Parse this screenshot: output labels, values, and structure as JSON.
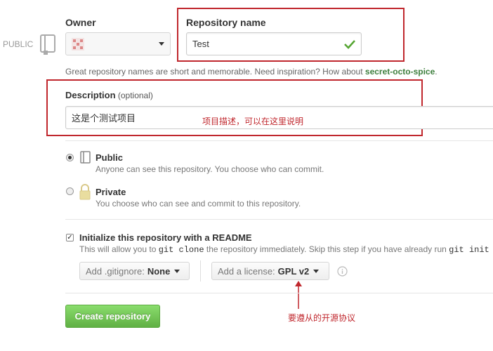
{
  "public_tag": "PUBLIC",
  "owner": {
    "label": "Owner"
  },
  "repo_name": {
    "label": "Repository name",
    "value": "Test"
  },
  "hint": {
    "prefix": "Great repository names are short and memorable. Need inspiration? How about ",
    "suggestion": "secret-octo-spice",
    "suffix": "."
  },
  "description": {
    "label": "Description",
    "optional": "(optional)",
    "value": "这是个测试项目",
    "annotation": "项目描述，可以在这里说明"
  },
  "visibility": {
    "public_label": "Public",
    "public_desc": "Anyone can see this repository. You choose who can commit.",
    "private_label": "Private",
    "private_desc": "You choose who can see and commit to this repository."
  },
  "init": {
    "label": "Initialize this repository with a README",
    "desc_pre": "This will allow you to ",
    "desc_code1": "git clone",
    "desc_mid": " the repository immediately. Skip this step if you have already run ",
    "desc_code2": "git init"
  },
  "gitignore": {
    "prefix": "Add .gitignore:",
    "value": "None"
  },
  "license": {
    "prefix": "Add a license:",
    "value": "GPL v2",
    "annotation": "要遵从的开源协议"
  },
  "create_button": "Create repository",
  "colors": {
    "annotation_red": "#c0272d",
    "create_green": "#6cc644",
    "checkmark_green": "#55a532"
  }
}
